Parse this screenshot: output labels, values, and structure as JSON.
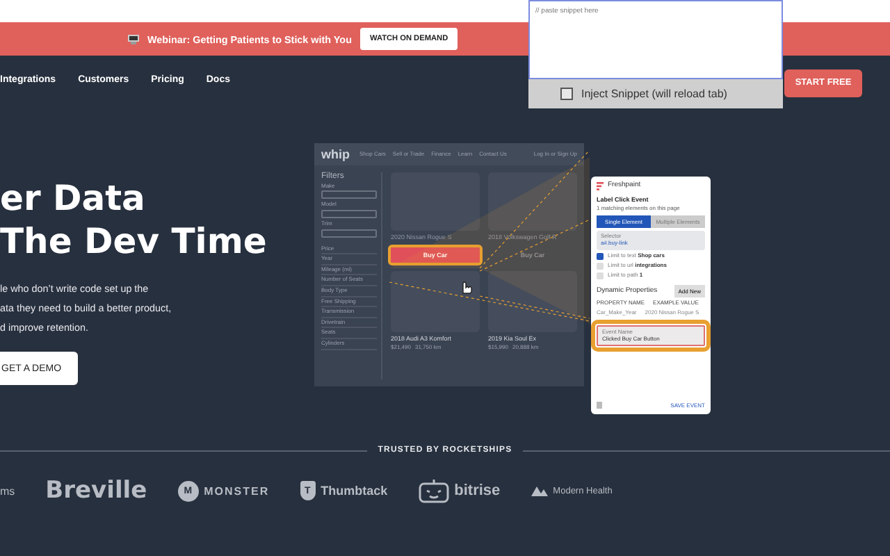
{
  "popup": {
    "placeholder": "// paste snippet here",
    "inject": {
      "label": "Inject Snippet (will reload tab)",
      "checked": false
    }
  },
  "banner": {
    "text": "Webinar: Getting Patients to Stick with You",
    "button": "WATCH ON DEMAND"
  },
  "nav": {
    "links": [
      "Integrations",
      "Customers",
      "Pricing",
      "Docs"
    ],
    "cta": "START FREE"
  },
  "hero": {
    "title_lines": [
      "er Data",
      "The Dev Time"
    ],
    "paragraph_lines": [
      "le who don’t write code set up the",
      "ata they need to build a better product,",
      "d improve retention."
    ],
    "button": "GET A DEMO"
  },
  "mock_site": {
    "logo": "whip",
    "links": [
      "Shop Cars",
      "Sell or Trade",
      "Finance",
      "Learn",
      "Contact Us"
    ],
    "account": "Log In or Sign Up",
    "filters": {
      "title": "Filters",
      "fields": [
        "Make",
        "Model",
        "Trim"
      ],
      "items": [
        "Price",
        "Year",
        "Mileage (mi)",
        "Number of Seats",
        "Body Type",
        "Free Shipping",
        "Transmission",
        "Drivetrain",
        "Seats",
        "Cylinders"
      ]
    },
    "columns": [
      {
        "top": {
          "title": "2020 Nissan Rogue S"
        },
        "buy": {
          "label": "Buy Car",
          "highlighted": true
        },
        "bottom": {
          "title": "2018 Audi A3 Komfort",
          "price": "$21,490",
          "mileage": "31,750 km"
        }
      },
      {
        "top": {
          "title": "2018 Volkswagen Golf R"
        },
        "buy": {
          "label": "Buy Car",
          "highlighted": false
        },
        "bottom": {
          "title": "2019 Kia Soul Ex",
          "price": "$15,990",
          "mileage": "20,888 km"
        }
      }
    ]
  },
  "extension_panel": {
    "brand": "Freshpaint",
    "title": "Label Click Event",
    "matches": "1 matching elements on this page",
    "tabs": [
      {
        "label": "Single Element",
        "selected": true
      },
      {
        "label": "Multiple Elements",
        "selected": false
      }
    ],
    "selector": {
      "label": "Selector",
      "value": "a#.buy-link"
    },
    "limits": [
      {
        "label": "Limit to text",
        "value": "Shop cars",
        "checked": true
      },
      {
        "label": "Limit to url",
        "value": "integrations",
        "checked": false
      },
      {
        "label": "Limit to path",
        "value": "1",
        "checked": false
      }
    ],
    "dynamic": {
      "title": "Dynamic Properties",
      "button": "Add New",
      "columns": [
        "PROPERTY NAME",
        "EXAMPLE VALUE"
      ],
      "row": [
        "Car_Make_Year",
        "2020 Nissan Rogue S"
      ]
    },
    "event_name": {
      "label": "Event Name",
      "value": "Clicked Buy Car Button"
    },
    "save": "SAVE EVENT"
  },
  "trusted": {
    "heading": "TRUSTED BY ROCKETSHIPS",
    "logos": [
      {
        "kind": "plain",
        "label": "ms"
      },
      {
        "kind": "bold",
        "label": "Breville"
      },
      {
        "kind": "circle-mark",
        "mark": "M",
        "label": "MONSTER"
      },
      {
        "kind": "shield-mark",
        "mark": "T",
        "label": "Thumbtack"
      },
      {
        "kind": "robot",
        "label": "bitrise"
      },
      {
        "kind": "mountains",
        "label": "Modern Health"
      }
    ]
  }
}
